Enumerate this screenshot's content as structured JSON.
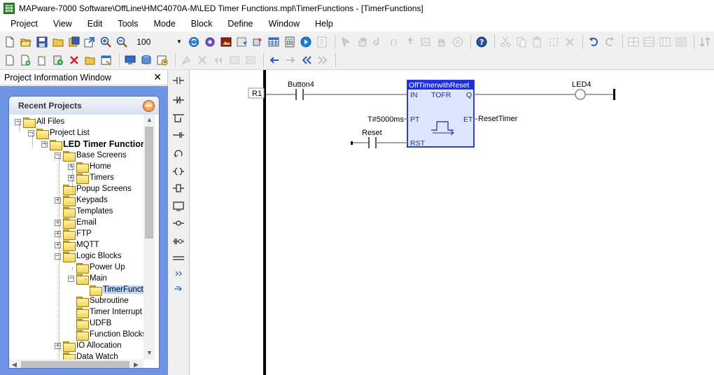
{
  "window": {
    "title": "MAPware-7000 Software\\OffLine\\HMC4070A-M\\LED Timer Functions.mpl\\TimerFunctions - [TimerFunctions]"
  },
  "menu": [
    "Project",
    "View",
    "Edit",
    "Tools",
    "Mode",
    "Block",
    "Define",
    "Window",
    "Help"
  ],
  "toolbar": {
    "zoom_value": "100"
  },
  "project_panel": {
    "title": "Project Information Window",
    "recent_title": "Recent Projects",
    "tree": [
      {
        "label": "All Files",
        "level": 0,
        "exp": "-"
      },
      {
        "label": "Project List",
        "level": 1,
        "exp": "-"
      },
      {
        "label": "LED Timer Functions",
        "level": 2,
        "exp": "-",
        "bold": true
      },
      {
        "label": "Base Screens",
        "level": 3,
        "exp": "-"
      },
      {
        "label": "Home",
        "level": 4,
        "exp": "+"
      },
      {
        "label": "Timers",
        "level": 4,
        "exp": "+"
      },
      {
        "label": "Popup Screens",
        "level": 3,
        "exp": ""
      },
      {
        "label": "Keypads",
        "level": 3,
        "exp": "+"
      },
      {
        "label": "Templates",
        "level": 3,
        "exp": ""
      },
      {
        "label": "Email",
        "level": 3,
        "exp": "+"
      },
      {
        "label": "FTP",
        "level": 3,
        "exp": "+"
      },
      {
        "label": "MQTT",
        "level": 3,
        "exp": "+"
      },
      {
        "label": "Logic Blocks",
        "level": 3,
        "exp": "-"
      },
      {
        "label": "Power Up",
        "level": 4,
        "exp": ""
      },
      {
        "label": "Main",
        "level": 4,
        "exp": "-"
      },
      {
        "label": "TimerFunctions",
        "level": 5,
        "exp": "",
        "selected": true,
        "open": true
      },
      {
        "label": "Subroutine",
        "level": 4,
        "exp": ""
      },
      {
        "label": "Timer Interrupt",
        "level": 4,
        "exp": ""
      },
      {
        "label": "UDFB",
        "level": 4,
        "exp": ""
      },
      {
        "label": "Function Blocks",
        "level": 4,
        "exp": ""
      },
      {
        "label": "IO Allocation",
        "level": 3,
        "exp": "+"
      },
      {
        "label": "Data Watch",
        "level": 3,
        "exp": ""
      }
    ]
  },
  "ladder": {
    "rung_label": "R1",
    "contact1_label": "Button4",
    "coil_label": "LED4",
    "block_title": "OffTimerwithReset",
    "block_type": "TOFR",
    "pin_in": "IN",
    "pin_q": "Q",
    "pin_pt": "PT",
    "pin_et": "ET",
    "pin_rst": "RST",
    "pt_value": "T#5000ms",
    "et_output": "ResetTimer",
    "reset_label": "Reset"
  },
  "colors": {
    "block_fill": "#dde6ff",
    "block_border": "#2a3fd6",
    "block_title_bg": "#1f2fe0",
    "panel_blue": "#6f94e6"
  }
}
